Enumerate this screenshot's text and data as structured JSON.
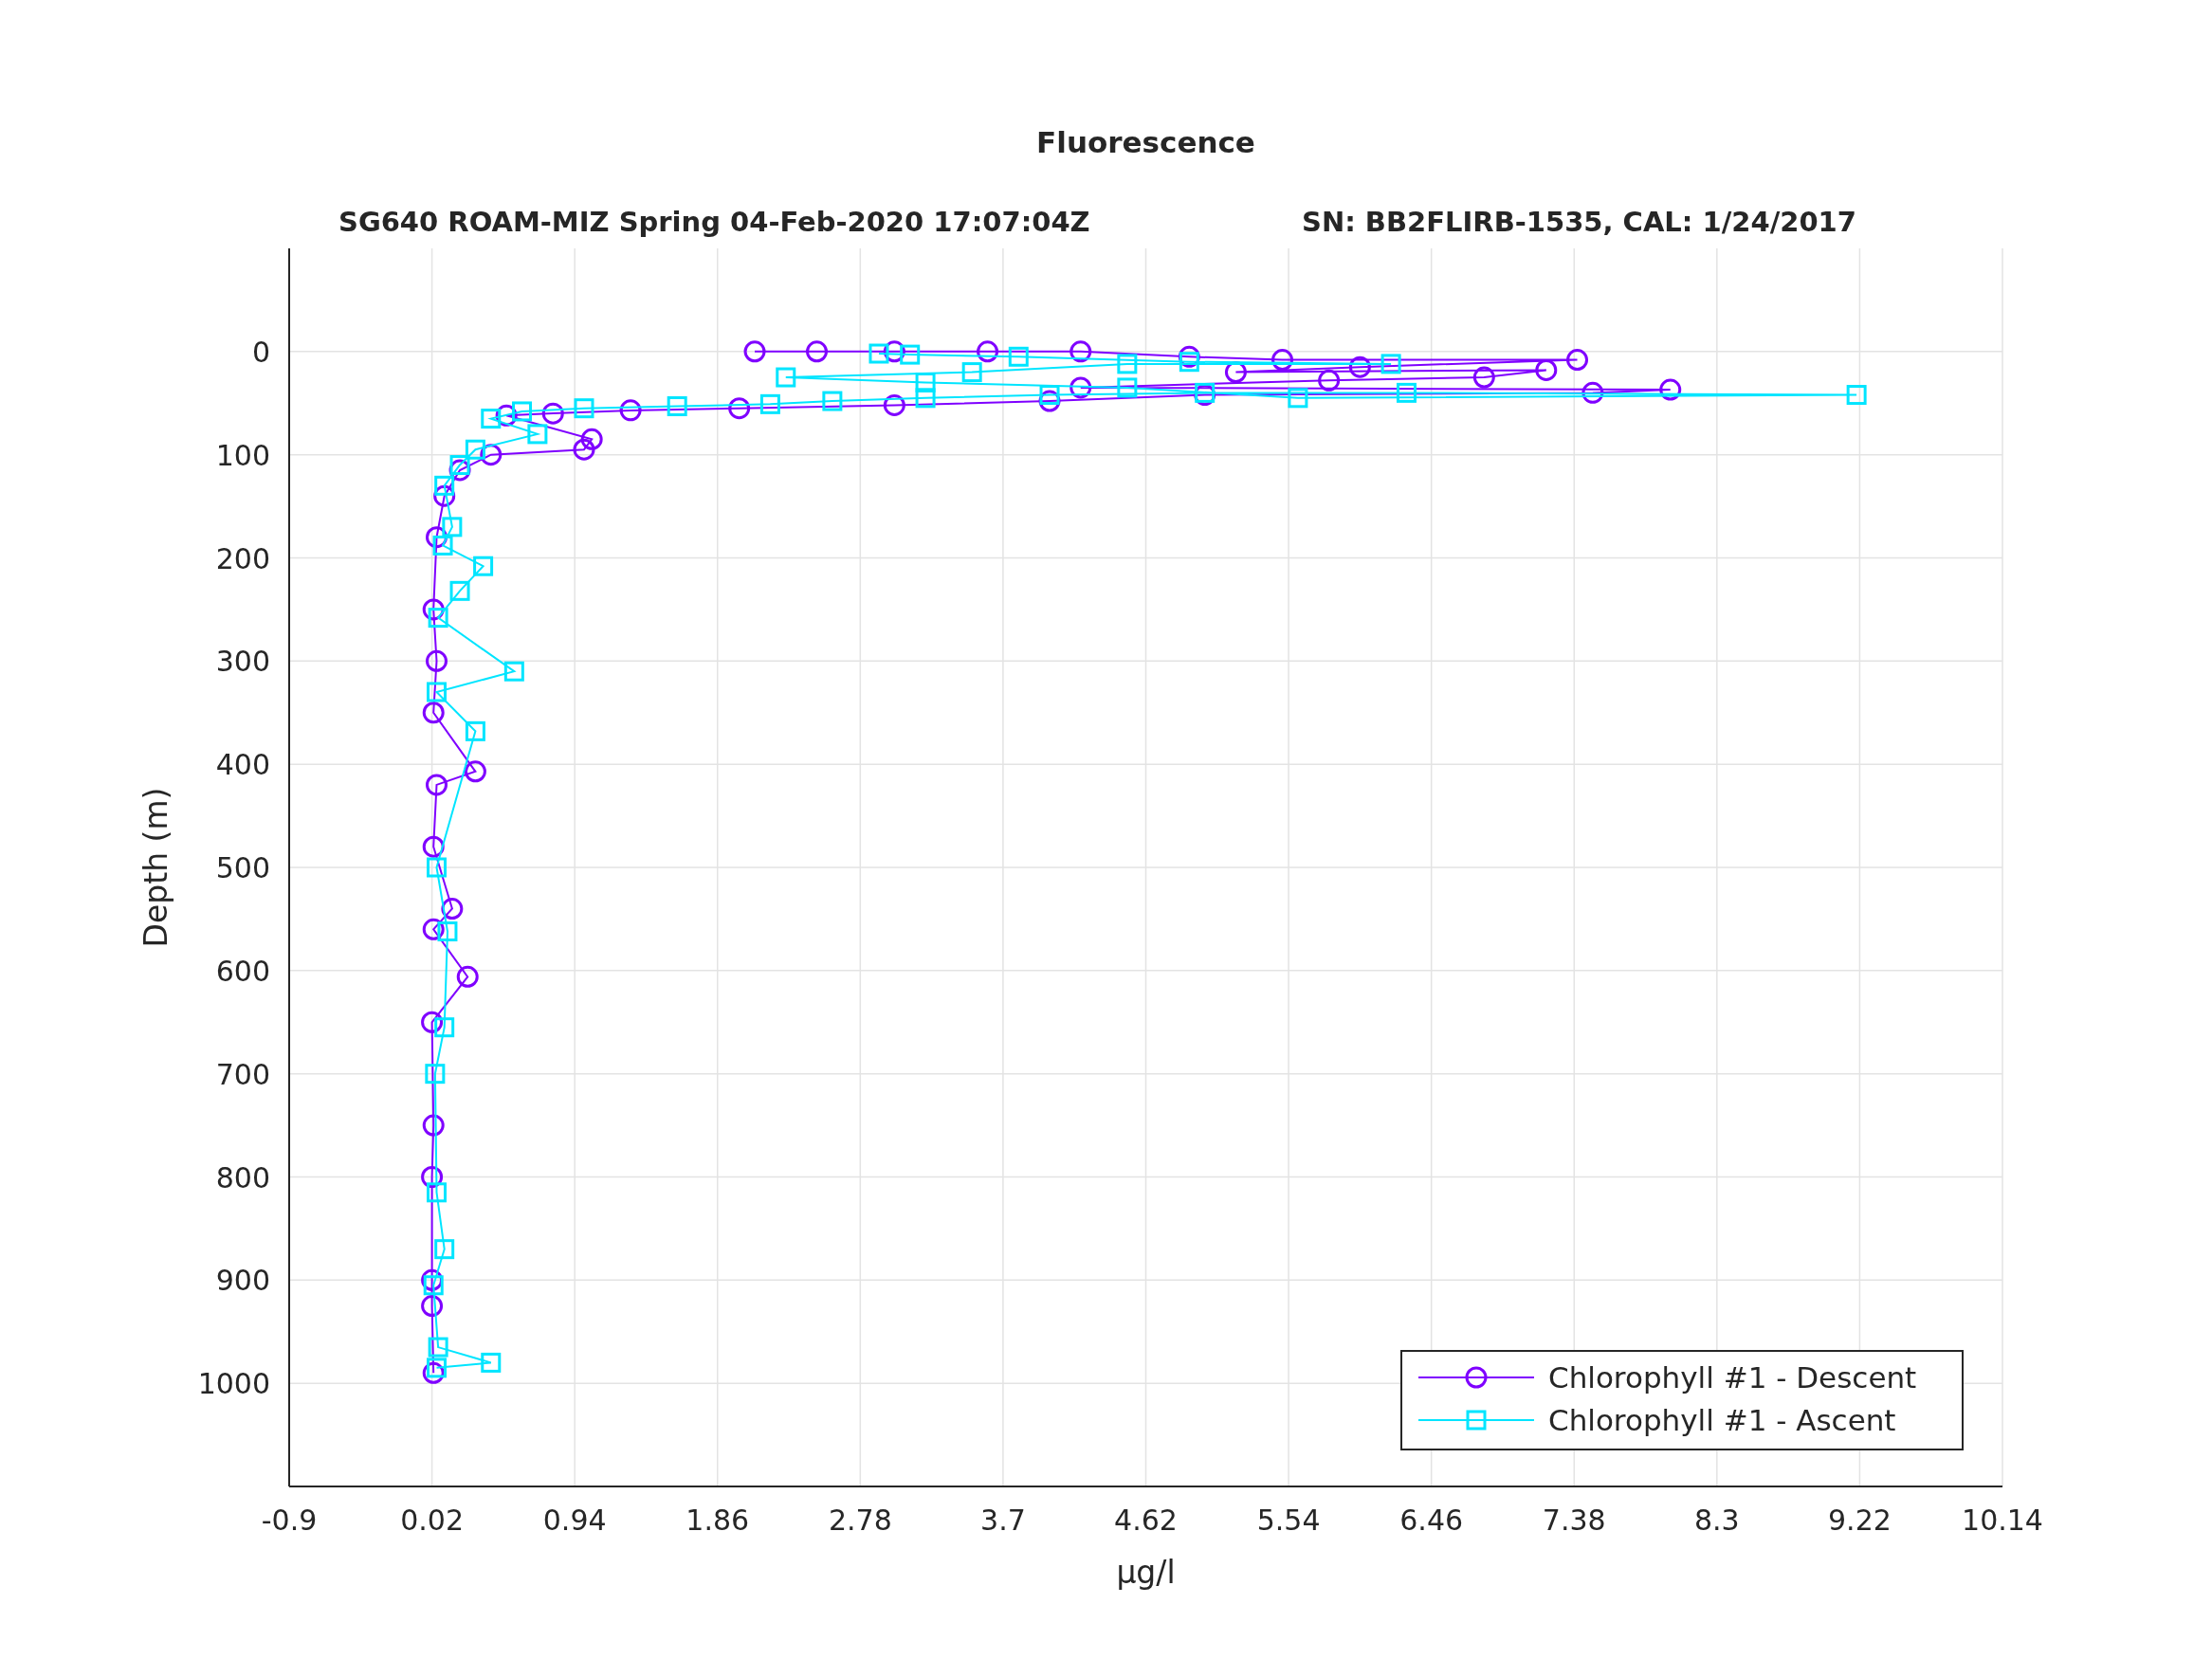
{
  "figure": {
    "subtitle": [
      "SG640 ROAM-MIZ Spring 04-Feb-2020 17:07:04Z",
      "SN: BB2FLIRB-1535, CAL: 1/24/2017"
    ],
    "chart_data": {
      "type": "line",
      "title": "Fluorescence",
      "xlabel": "μg/l",
      "ylabel": "Depth (m)",
      "grid": true,
      "legend": true,
      "xlim": [
        -0.9,
        10.14
      ],
      "ylim": [
        1100,
        -100
      ],
      "xticks": [
        -0.9,
        0.02,
        0.94,
        1.86,
        2.78,
        3.7,
        4.62,
        5.54,
        6.46,
        7.38,
        8.3,
        9.22,
        10.14
      ],
      "yticks": [
        0,
        100,
        200,
        300,
        400,
        500,
        600,
        700,
        800,
        900,
        1000
      ],
      "series": [
        {
          "name": "Chlorophyll #1 - Descent",
          "color": "#7f00ff",
          "marker": "circle",
          "x": [
            2.1,
            2.5,
            3.0,
            3.6,
            4.2,
            4.9,
            5.5,
            7.4,
            6.0,
            5.2,
            7.2,
            6.8,
            5.8,
            4.2,
            8.0,
            7.5,
            5.0,
            4.0,
            3.0,
            2.0,
            1.3,
            0.8,
            0.5,
            1.05,
            1.0,
            0.4,
            0.2,
            0.1,
            0.05,
            0.03,
            0.05,
            0.03,
            0.3,
            0.05,
            0.03,
            0.15,
            0.03,
            0.25,
            0.02,
            0.03,
            0.02,
            0.02,
            0.02,
            0.03
          ],
          "values": [
            0,
            0,
            0,
            0,
            0,
            5,
            8,
            8,
            15,
            20,
            18,
            25,
            28,
            35,
            37,
            40,
            42,
            48,
            52,
            55,
            57,
            60,
            62,
            85,
            95,
            100,
            115,
            140,
            180,
            250,
            300,
            350,
            407,
            420,
            480,
            540,
            560,
            606,
            650,
            750,
            800,
            900,
            925,
            990
          ]
        },
        {
          "name": "Chlorophyll #1 - Ascent",
          "color": "#00e5ff",
          "marker": "square",
          "x": [
            0.05,
            0.4,
            0.06,
            0.03,
            0.1,
            0.05,
            0.04,
            0.1,
            0.12,
            0.05,
            0.3,
            0.05,
            0.55,
            0.06,
            0.2,
            0.35,
            0.09,
            0.15,
            0.1,
            0.2,
            0.3,
            0.7,
            0.4,
            0.6,
            1.0,
            1.6,
            2.2,
            2.6,
            3.2,
            4.0,
            5.0,
            6.3,
            9.2,
            5.6,
            4.5,
            3.2,
            2.3,
            3.5,
            4.5,
            6.2,
            4.9,
            3.8,
            3.1,
            2.9
          ],
          "values": [
            985,
            980,
            965,
            905,
            870,
            815,
            700,
            655,
            562,
            500,
            368,
            330,
            310,
            258,
            232,
            208,
            188,
            170,
            130,
            110,
            95,
            80,
            65,
            58,
            55,
            53,
            51,
            48,
            45,
            42,
            40,
            40,
            42,
            45,
            35,
            30,
            25,
            20,
            12,
            12,
            10,
            5,
            3,
            2
          ]
        }
      ]
    }
  }
}
